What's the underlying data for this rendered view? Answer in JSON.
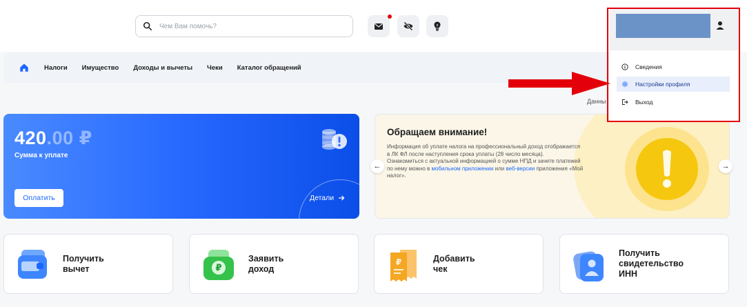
{
  "header": {
    "search_placeholder": "Чем Вам помочь?",
    "icons": [
      "mail-icon",
      "eye-off-icon",
      "lightbulb-icon"
    ],
    "mail_has_notification": true
  },
  "nav": {
    "items": [
      "Налоги",
      "Имущество",
      "Доходы и вычеты",
      "Чеки",
      "Каталог обращений"
    ],
    "truncated_text": "Данны"
  },
  "balance_card": {
    "amount_int": "420",
    "amount_frac": ".00 ₽",
    "label": "Сумма к уплате",
    "pay_button": "Оплатить",
    "details_link": "Детали"
  },
  "notice": {
    "title": "Обращаем внимание!",
    "body_1": "Информация об уплате налога на профессиональный доход отображается в ЛК ФЛ после наступления срока уплаты (28 число месяца).",
    "body_2": "Ознакомиться с актуальной информацией о сумме НПД и зачете платежей по нему можно в ",
    "link_1": "мобильном приложении",
    "body_3": " или ",
    "link_2": "веб-версии",
    "body_4": " приложения «Мой налог»."
  },
  "actions": [
    {
      "line1": "Получить",
      "line2": "вычет",
      "line3": ""
    },
    {
      "line1": "Заявить",
      "line2": "доход",
      "line3": ""
    },
    {
      "line1": "Добавить",
      "line2": "чек",
      "line3": ""
    },
    {
      "line1": "Получить",
      "line2": "свидетельство",
      "line3": "ИНН"
    }
  ],
  "dropdown": {
    "items": [
      "Сведения",
      "Настройки профиля",
      "Выход"
    ],
    "active_index": 1
  },
  "colors": {
    "accent": "#1a66ff",
    "highlight_frame": "#e3000b"
  }
}
